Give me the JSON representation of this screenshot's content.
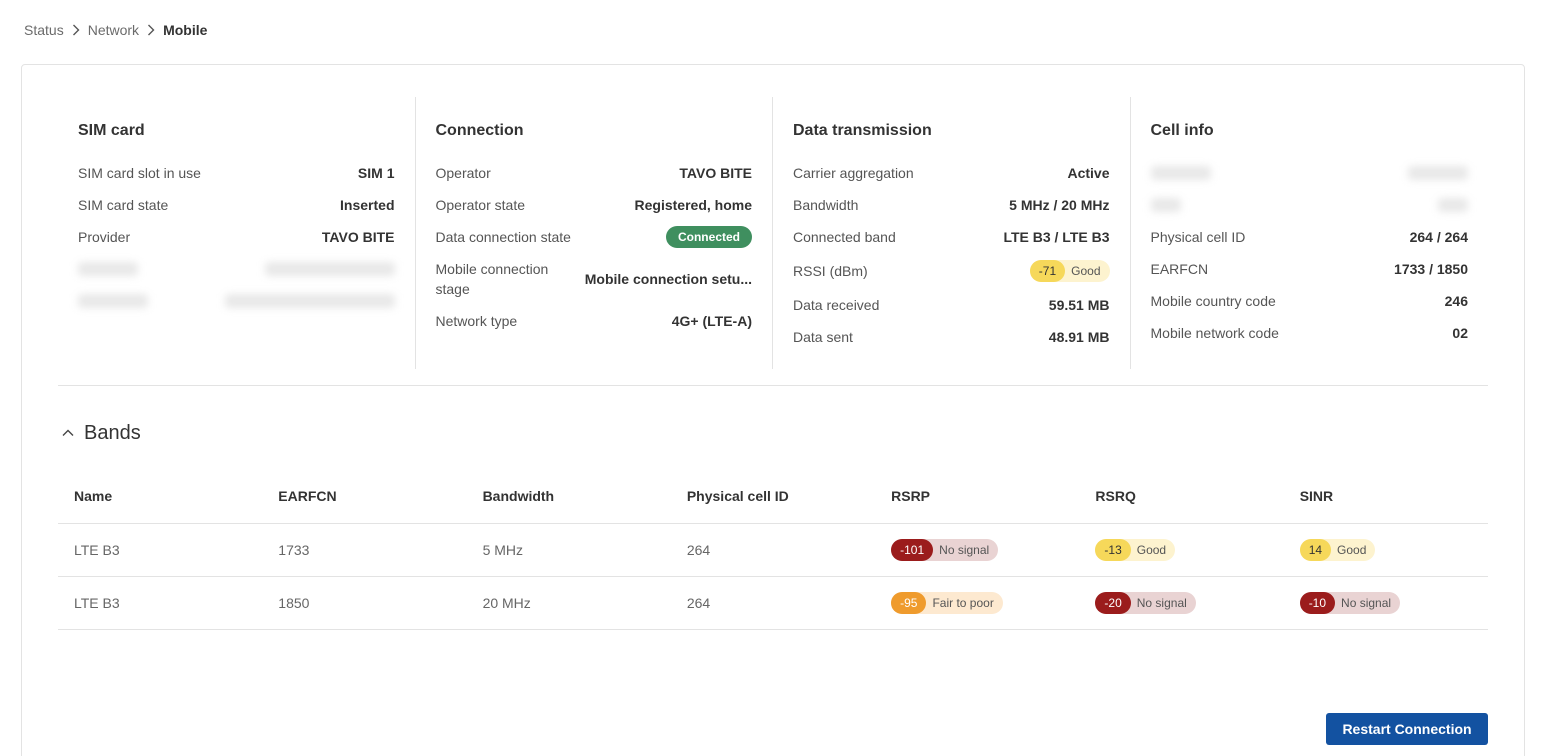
{
  "breadcrumb": {
    "items": [
      "Status",
      "Network"
    ],
    "current": "Mobile"
  },
  "sim_card": {
    "title": "SIM card",
    "rows": [
      {
        "label": "SIM card slot in use",
        "value": "SIM 1"
      },
      {
        "label": "SIM card state",
        "value": "Inserted"
      },
      {
        "label": "Provider",
        "value": "TAVO BITE"
      }
    ]
  },
  "connection": {
    "title": "Connection",
    "operator_label": "Operator",
    "operator_value": "TAVO BITE",
    "operator_state_label": "Operator state",
    "operator_state_value": "Registered, home",
    "data_state_label": "Data connection state",
    "data_state_value": "Connected",
    "stage_label": "Mobile connection stage",
    "stage_value": "Mobile connection setu...",
    "network_type_label": "Network type",
    "network_type_value": "4G+ (LTE-A)"
  },
  "data_transmission": {
    "title": "Data transmission",
    "ca_label": "Carrier aggregation",
    "ca_value": "Active",
    "bandwidth_label": "Bandwidth",
    "bandwidth_value": "5 MHz / 20 MHz",
    "band_label": "Connected band",
    "band_value": "LTE B3 / LTE B3",
    "rssi_label": "RSSI (dBm)",
    "rssi_value": "-71",
    "rssi_quality": "Good",
    "received_label": "Data received",
    "received_value": "59.51 MB",
    "sent_label": "Data sent",
    "sent_value": "48.91 MB"
  },
  "cell_info": {
    "title": "Cell info",
    "rows": [
      {
        "label": "Physical cell ID",
        "value": "264 / 264"
      },
      {
        "label": "EARFCN",
        "value": "1733 / 1850"
      },
      {
        "label": "Mobile country code",
        "value": "246"
      },
      {
        "label": "Mobile network code",
        "value": "02"
      }
    ]
  },
  "bands": {
    "title": "Bands",
    "columns": [
      "Name",
      "EARFCN",
      "Bandwidth",
      "Physical cell ID",
      "RSRP",
      "RSRQ",
      "SINR"
    ],
    "rows": [
      {
        "name": "LTE B3",
        "earfcn": "1733",
        "bandwidth": "5 MHz",
        "pci": "264",
        "rsrp": "-101",
        "rsrp_q": "No signal",
        "rsrq": "-13",
        "rsrq_q": "Good",
        "sinr": "14",
        "sinr_q": "Good"
      },
      {
        "name": "LTE B3",
        "earfcn": "1850",
        "bandwidth": "20 MHz",
        "pci": "264",
        "rsrp": "-95",
        "rsrp_q": "Fair to poor",
        "rsrq": "-20",
        "rsrq_q": "No signal",
        "sinr": "-10",
        "sinr_q": "No signal"
      }
    ]
  },
  "actions": {
    "restart_label": "Restart Connection"
  },
  "colors": {
    "primary": "#1352a1",
    "connected": "#3f8f5f",
    "good": "#f6d85a",
    "fair": "#ef9b2d",
    "no_signal": "#9b1c1c"
  }
}
